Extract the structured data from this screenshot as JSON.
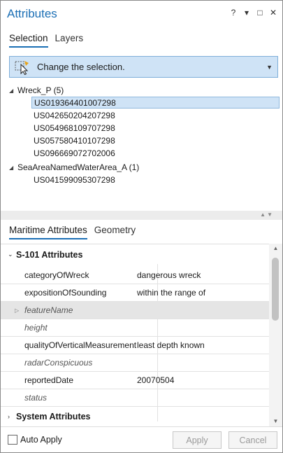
{
  "window": {
    "title": "Attributes",
    "controls": {
      "help": "?",
      "menu": "▾",
      "maximize": "□",
      "close": "✕"
    }
  },
  "top_tabs": [
    {
      "label": "Selection",
      "active": true
    },
    {
      "label": "Layers",
      "active": false
    }
  ],
  "change_selection": {
    "label": "Change the selection.",
    "icon": "selection-cursor-icon"
  },
  "tree": {
    "groups": [
      {
        "label": "Wreck_P (5)",
        "items": [
          {
            "label": "US019364401007298",
            "selected": true
          },
          {
            "label": "US042650204207298",
            "selected": false
          },
          {
            "label": "US054968109707298",
            "selected": false
          },
          {
            "label": "US057580410107298",
            "selected": false
          },
          {
            "label": "US096669072702006",
            "selected": false
          }
        ]
      },
      {
        "label": "SeaAreaNamedWaterArea_A (1)",
        "items": [
          {
            "label": "US041599095307298",
            "selected": false
          }
        ]
      }
    ]
  },
  "bottom_tabs": [
    {
      "label": "Maritime Attributes",
      "active": true
    },
    {
      "label": "Geometry",
      "active": false
    }
  ],
  "attributes": {
    "section1": "S-101 Attributes",
    "rows": [
      {
        "name": "categoryOfWreck",
        "value": "dangerous wreck"
      },
      {
        "name": "expositionOfSounding",
        "value": "within the range of"
      },
      {
        "name": "featureName",
        "value": ""
      },
      {
        "name": "height",
        "value": ""
      },
      {
        "name": "qualityOfVerticalMeasurement",
        "value": "least depth known"
      },
      {
        "name": "radarConspicuous",
        "value": ""
      },
      {
        "name": "reportedDate",
        "value": "20070504"
      },
      {
        "name": "status",
        "value": ""
      }
    ],
    "section2": "System Attributes"
  },
  "footer": {
    "auto_apply": "Auto Apply",
    "apply": "Apply",
    "cancel": "Cancel"
  },
  "colors": {
    "accent": "#1b6fb5",
    "selection_bg": "#cfe3f6"
  }
}
